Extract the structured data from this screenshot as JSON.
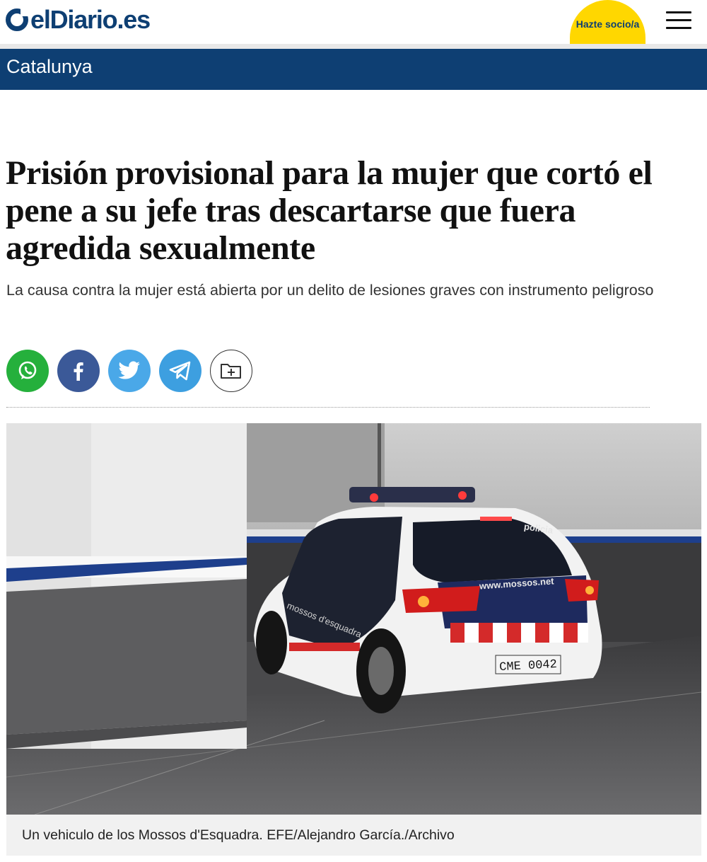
{
  "header": {
    "logo_text": "elDiario.es",
    "partner_button": "Hazte socio/a",
    "menu_icon": "hamburger-menu-icon"
  },
  "section": {
    "label": "Catalunya"
  },
  "article": {
    "headline": "Prisión provisional para la mujer que cortó el pene a su jefe tras descartarse que fuera agredida sexualmente",
    "subtitle": "La causa contra la mujer está abierta por un delito de lesiones graves con instrumento peligroso"
  },
  "share": {
    "buttons": [
      {
        "icon": "whatsapp-icon",
        "color": "#25b03c"
      },
      {
        "icon": "facebook-icon",
        "color": "#3b5998"
      },
      {
        "icon": "twitter-icon",
        "color": "#4aa8e8"
      },
      {
        "icon": "telegram-icon",
        "color": "#3d9fe0"
      },
      {
        "icon": "add-to-folder-icon",
        "color": "#ffffff"
      }
    ]
  },
  "photo": {
    "caption": "Un vehiculo de los Mossos d'Esquadra. EFE/Alejandro García./Archivo",
    "car_web_text": "www.mossos.net",
    "car_roof_text": "policia",
    "car_side_text": "mossos d'esquadra",
    "license_plate": "CME 0042"
  },
  "colors": {
    "brand_blue": "#0e3f73",
    "partner_yellow": "#ffd700"
  }
}
